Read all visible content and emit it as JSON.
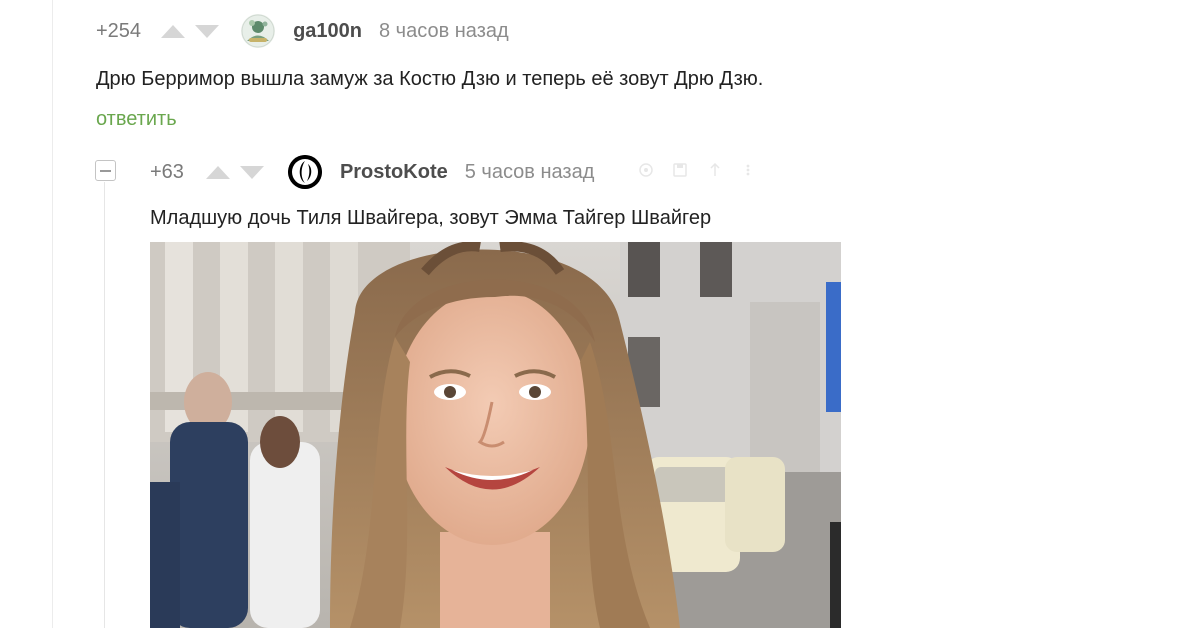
{
  "comments": [
    {
      "rating": "+254",
      "username": "ga100n",
      "time": "8 часов назад",
      "text": "Дрю Берримор вышла замуж за Костю Дзю и теперь её зовут Дрю Дзю.",
      "reply_label": "ответить"
    },
    {
      "rating": "+63",
      "username": "ProstoKote",
      "time": "5 часов назад",
      "text": "Младшую дочь Тиля Швайгера, зовут Эмма Тайгер Швайгер"
    }
  ],
  "icons": {
    "vote_up": "arrow-up-icon",
    "vote_down": "arrow-down-icon",
    "collapse": "minus-icon",
    "actions": [
      "link-icon",
      "save-icon",
      "share-icon",
      "more-icon"
    ]
  },
  "colors": {
    "reply": "#6aa74e",
    "vote_arrow": "#d6d6d6",
    "meta": "#8c8c8c"
  }
}
